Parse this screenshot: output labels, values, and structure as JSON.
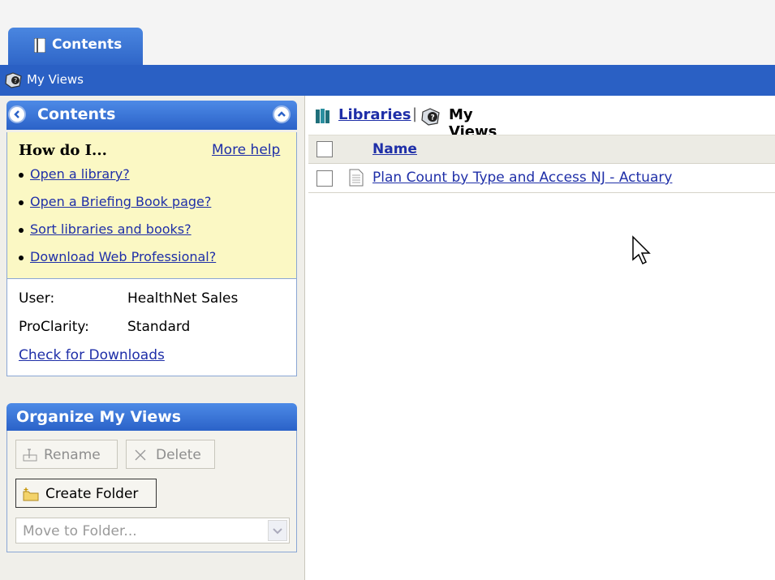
{
  "tabs": [
    {
      "label": "Contents",
      "icon": "book-icon",
      "active": true
    }
  ],
  "header_bar": {
    "label": "My Views",
    "icon": "my-views-icon"
  },
  "left_panel": {
    "contents_title": "Contents",
    "how_do_i": {
      "title": "How do I...",
      "more_help": "More help",
      "links": [
        "Open a library?",
        "Open a Briefing Book page?",
        "Sort libraries and books?",
        "Download Web Professional?"
      ]
    },
    "user_info": {
      "user_label": "User:",
      "user_value": "HealthNet Sales",
      "proclarity_label": "ProClarity:",
      "proclarity_value": "Standard",
      "check_downloads": "Check for Downloads"
    },
    "organize": {
      "title": "Organize My Views",
      "rename": "Rename",
      "delete": "Delete",
      "create_folder": "Create Folder",
      "move_to_folder": "Move to Folder..."
    }
  },
  "main": {
    "breadcrumb": {
      "libraries": "Libraries",
      "separator": "|",
      "current": "My Views"
    },
    "table": {
      "header": "Name",
      "rows": [
        {
          "name": "Plan Count by Type and Access NJ - Actuary"
        }
      ]
    }
  },
  "colors": {
    "bar_blue": "#2a60c4",
    "link": "#1f2fa8",
    "help_bg": "#fbf8c4"
  }
}
